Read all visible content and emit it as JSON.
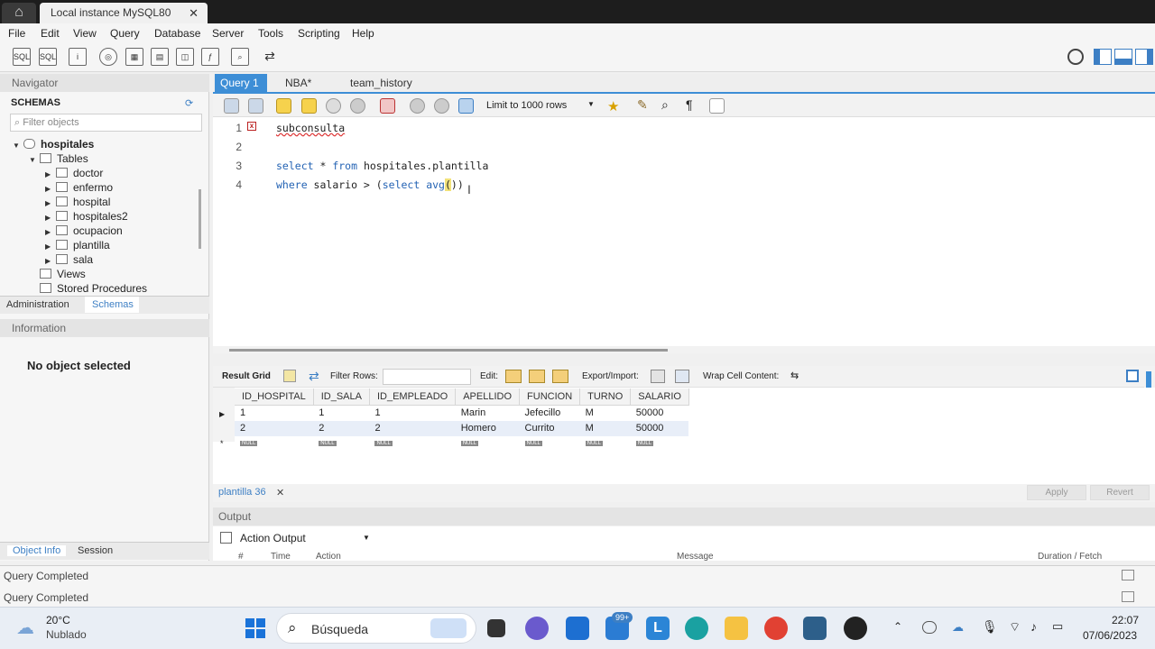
{
  "window": {
    "home_icon": "home-icon",
    "tab_title": "Local instance MySQL80",
    "close": "✕"
  },
  "menu": [
    "File",
    "Edit",
    "View",
    "Query",
    "Database",
    "Server",
    "Tools",
    "Scripting",
    "Help"
  ],
  "navigator": {
    "header": "Navigator",
    "schemas_label": "SCHEMAS",
    "filter_placeholder": "Filter objects",
    "schema": "hospitales",
    "tables_label": "Tables",
    "tables": [
      "doctor",
      "enfermo",
      "hospital",
      "hospitales2",
      "ocupacion",
      "plantilla",
      "sala"
    ],
    "views_label": "Views",
    "procs_label": "Stored Procedures",
    "tab_admin": "Administration",
    "tab_schemas": "Schemas",
    "info_header": "Information",
    "no_object": "No object selected",
    "tab_objinfo": "Object Info",
    "tab_session": "Session"
  },
  "editor": {
    "tabs": [
      "Query 1",
      "NBA*",
      "team_history"
    ],
    "limit": "Limit to 1000 rows",
    "lines": [
      {
        "n": "1",
        "text": "subconsulta"
      },
      {
        "n": "2",
        "text": ""
      },
      {
        "n": "3",
        "text": "select * from hospitales.plantilla"
      },
      {
        "n": "4",
        "text": "where salario > (select avg())"
      }
    ]
  },
  "results": {
    "result_grid": "Result Grid",
    "filter_rows": "Filter Rows:",
    "edit": "Edit:",
    "export": "Export/Import:",
    "wrap": "Wrap Cell Content:",
    "columns": [
      "ID_HOSPITAL",
      "ID_SALA",
      "ID_EMPLEADO",
      "APELLIDO",
      "FUNCION",
      "TURNO",
      "SALARIO"
    ],
    "rows": [
      [
        "1",
        "1",
        "1",
        "Marin",
        "Jefecillo",
        "M",
        "50000"
      ],
      [
        "2",
        "2",
        "2",
        "Homero",
        "Currito",
        "M",
        "50000"
      ]
    ],
    "null_label": "NULL",
    "tab": "plantilla 36",
    "apply": "Apply",
    "revert": "Revert"
  },
  "output": {
    "header": "Output",
    "selector": "Action Output",
    "col_num": "#",
    "col_time": "Time",
    "col_action": "Action",
    "col_message": "Message",
    "col_duration": "Duration / Fetch"
  },
  "status": [
    "Query Completed",
    "Query Completed"
  ],
  "taskbar": {
    "temp": "20°C",
    "weather": "Nublado",
    "search": "Búsqueda",
    "badge": "99+",
    "time": "22:07",
    "date": "07/06/2023"
  }
}
